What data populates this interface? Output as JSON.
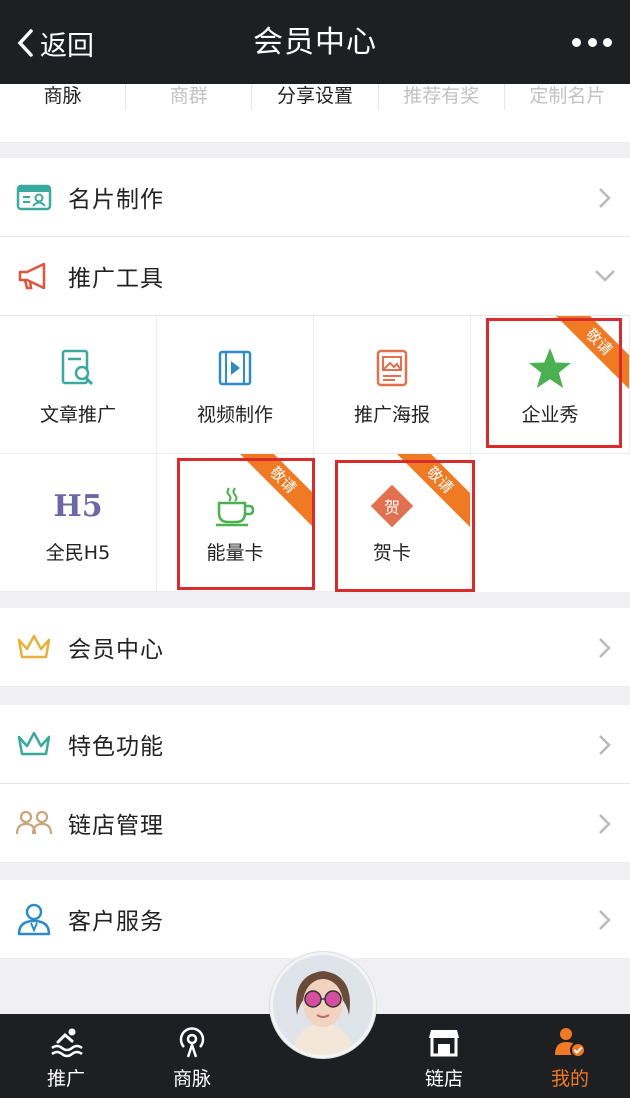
{
  "header": {
    "back_label": "返回",
    "title": "会员中心"
  },
  "tabs": [
    {
      "label": "商脉",
      "faded": false
    },
    {
      "label": "商群",
      "faded": true
    },
    {
      "label": "分享设置",
      "faded": false
    },
    {
      "label": "推荐有奖",
      "faded": true
    },
    {
      "label": "定制名片",
      "faded": true
    }
  ],
  "rows": {
    "card_making": "名片制作",
    "promo_tools": "推广工具",
    "member_center": "会员中心",
    "special_features": "特色功能",
    "chain_store": "链店管理",
    "customer_service": "客户服务"
  },
  "tools": [
    {
      "label": "文章推广",
      "badge": ""
    },
    {
      "label": "视频制作",
      "badge": ""
    },
    {
      "label": "推广海报",
      "badge": ""
    },
    {
      "label": "企业秀",
      "badge": "敬请"
    },
    {
      "label": "全民H5",
      "badge": ""
    },
    {
      "label": "能量卡",
      "badge": "敬请"
    },
    {
      "label": "贺卡",
      "badge": "敬请"
    }
  ],
  "h5_icon_text": "H5",
  "greeting_icon_text": "贺",
  "bottom_nav": [
    {
      "label": "推广",
      "active": false
    },
    {
      "label": "商脉",
      "active": false
    },
    {
      "label": "链店",
      "active": false
    },
    {
      "label": "我的",
      "active": true
    }
  ],
  "colors": {
    "bar": "#1e1f23",
    "accent": "#f07a24",
    "highlight_box": "#d92b2b",
    "star": "#4caf50"
  }
}
